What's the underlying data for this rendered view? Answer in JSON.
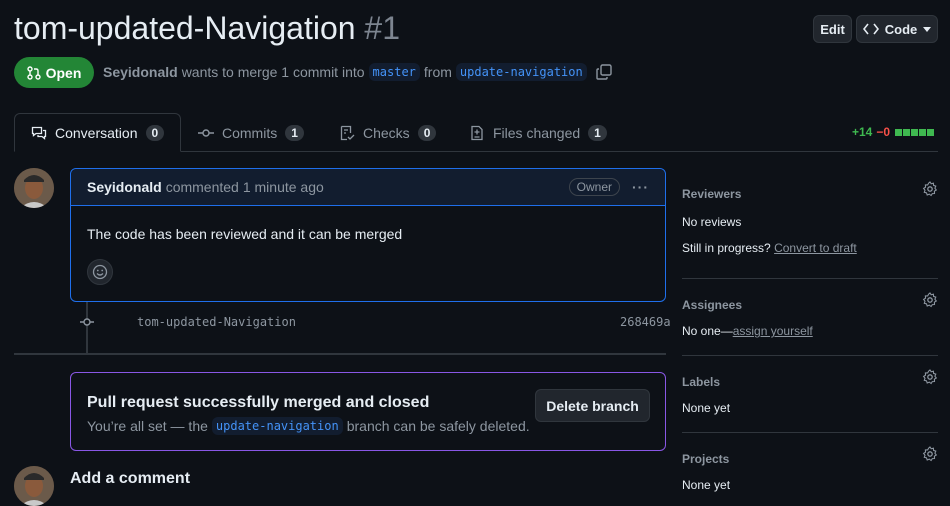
{
  "header": {
    "title": "tom-updated-Navigation",
    "number": "#1",
    "edit_label": "Edit",
    "code_label": "Code"
  },
  "status": {
    "state": "Open",
    "author": "Seyidonald",
    "text_1": "wants to merge 1 commit into",
    "base_branch": "master",
    "text_2": "from",
    "head_branch": "update-navigation"
  },
  "tabs": [
    {
      "label": "Conversation",
      "count": "0"
    },
    {
      "label": "Commits",
      "count": "1"
    },
    {
      "label": "Checks",
      "count": "0"
    },
    {
      "label": "Files changed",
      "count": "1"
    }
  ],
  "diffstat": {
    "additions": "+14",
    "deletions": "−0"
  },
  "comment": {
    "author": "Seyidonald",
    "action": "commented",
    "time": "1 minute ago",
    "role": "Owner",
    "body": "The code has been reviewed and it can be merged"
  },
  "commit": {
    "message": "tom-updated-Navigation",
    "sha": "268469a"
  },
  "merged": {
    "heading": "Pull request successfully merged and closed",
    "text_1": "You’re all set — the",
    "branch": "update-navigation",
    "text_2": "branch can be safely deleted.",
    "delete_label": "Delete branch"
  },
  "add_comment": {
    "heading": "Add a comment"
  },
  "sidebar": {
    "reviewers": {
      "title": "Reviewers",
      "value": "No reviews",
      "progress_text": "Still in progress?",
      "progress_link": "Convert to draft"
    },
    "assignees": {
      "title": "Assignees",
      "value": "No one—",
      "link": "assign yourself"
    },
    "labels": {
      "title": "Labels",
      "value": "None yet"
    },
    "projects": {
      "title": "Projects",
      "value": "None yet"
    }
  },
  "colors": {
    "open": "#238636",
    "accent": "#1f6feb",
    "merged": "#8957e5",
    "additions": "#3fb950",
    "deletions": "#f85149"
  }
}
